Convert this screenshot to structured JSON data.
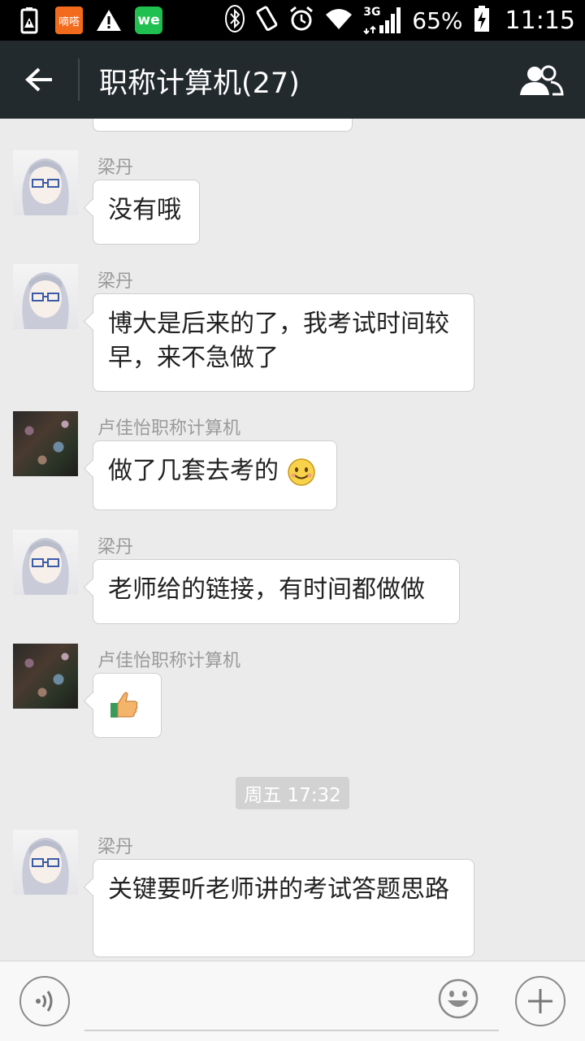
{
  "status_bar": {
    "app_icon_orange": "嘀嗒",
    "app_icon_green": "we",
    "network": "3G",
    "battery": "65%",
    "time": "11:15"
  },
  "header": {
    "title": "职称计算机(27)"
  },
  "messages": [
    {
      "sender": "梁丹",
      "text": "没有哦"
    },
    {
      "sender": "梁丹",
      "text": "博大是后来的了，我考试时间较早，来不急做了"
    },
    {
      "sender": "卢佳怡职称计算机",
      "text": "做了几套去考的"
    },
    {
      "sender": "梁丹",
      "text": "老师给的链接，有时间都做做"
    },
    {
      "sender": "卢佳怡职称计算机",
      "text": ""
    },
    {
      "sender": "梁丹",
      "text": "关键要听老师讲的考试答题思路"
    }
  ],
  "time_divider": "周五 17:32",
  "input": {
    "placeholder": ""
  }
}
